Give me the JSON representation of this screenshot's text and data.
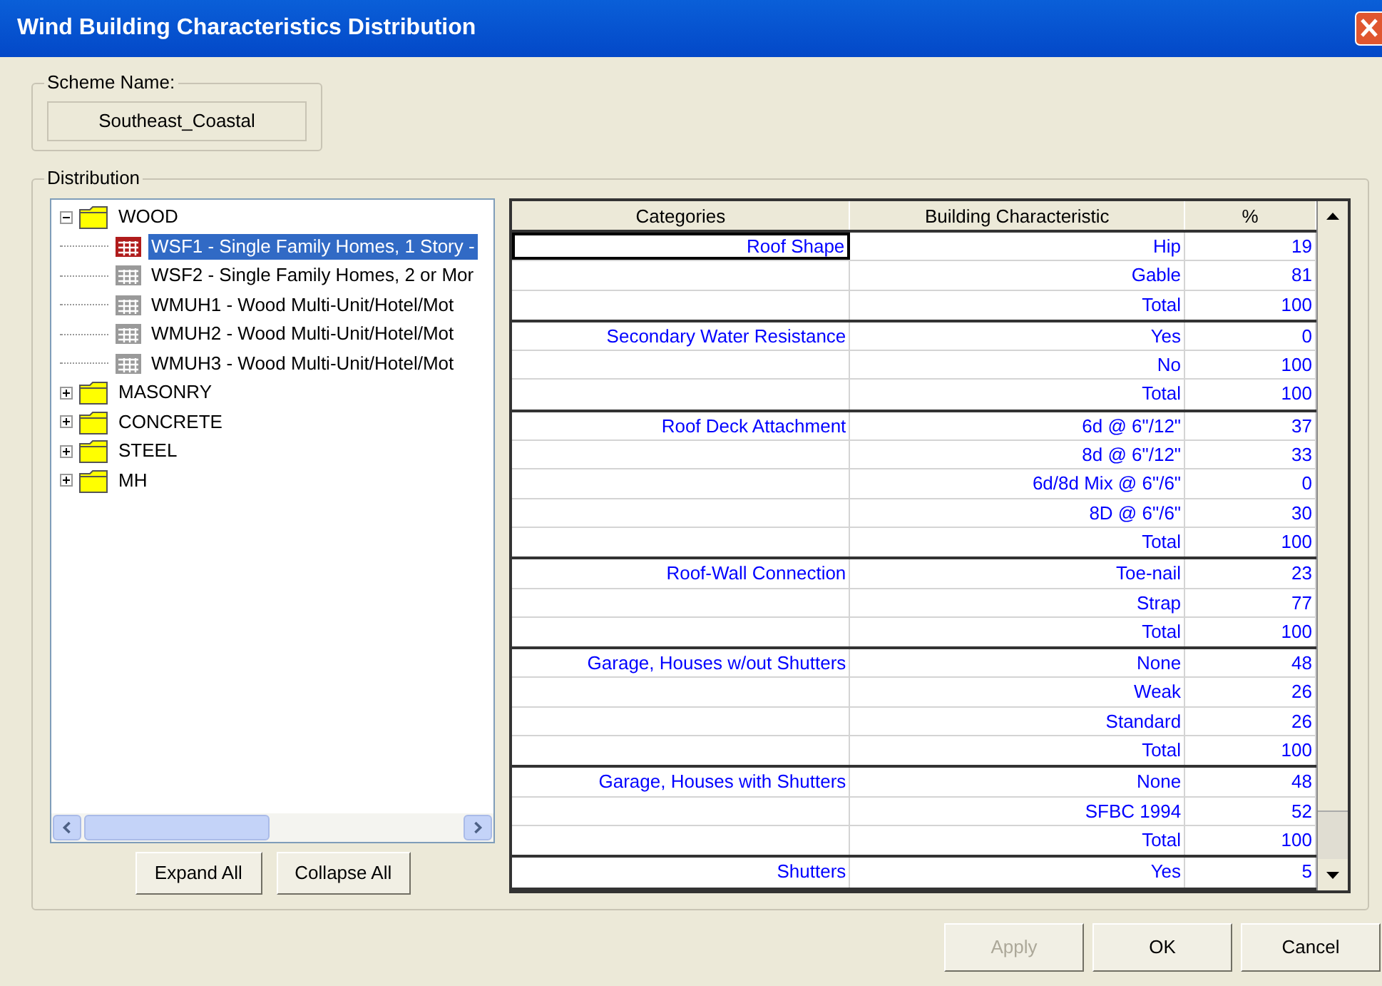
{
  "window": {
    "title": "Wind Building Characteristics Distribution"
  },
  "scheme": {
    "label": "Scheme Name:",
    "value": "Southeast_Coastal"
  },
  "distribution": {
    "label": "Distribution"
  },
  "tree": [
    {
      "label": "WOOD",
      "kind": "folder",
      "expanded": true,
      "selected": false,
      "children": [
        {
          "label": "WSF1 - Single Family Homes, 1 Story -",
          "kind": "item",
          "selected": true
        },
        {
          "label": "WSF2 - Single Family Homes, 2 or Mor",
          "kind": "item",
          "selected": false
        },
        {
          "label": "WMUH1 - Wood Multi-Unit/Hotel/Mot",
          "kind": "item",
          "selected": false
        },
        {
          "label": "WMUH2 - Wood Multi-Unit/Hotel/Mot",
          "kind": "item",
          "selected": false
        },
        {
          "label": "WMUH3 - Wood Multi-Unit/Hotel/Mot",
          "kind": "item",
          "selected": false
        }
      ]
    },
    {
      "label": "MASONRY",
      "kind": "folder",
      "expanded": false,
      "selected": false
    },
    {
      "label": "CONCRETE",
      "kind": "folder",
      "expanded": false,
      "selected": false
    },
    {
      "label": "STEEL",
      "kind": "folder",
      "expanded": false,
      "selected": false
    },
    {
      "label": "MH",
      "kind": "folder",
      "expanded": false,
      "selected": false
    }
  ],
  "tree_buttons": [
    "Expand All",
    "Collapse All"
  ],
  "table": {
    "columns": [
      "Categories",
      "Building Characteristic",
      "%"
    ],
    "groups": [
      {
        "category": "Roof Shape",
        "selected": true,
        "rows": [
          {
            "characteristic": "Hip",
            "percent": "19"
          },
          {
            "characteristic": "Gable",
            "percent": "81"
          },
          {
            "characteristic": "Total",
            "percent": "100"
          }
        ]
      },
      {
        "category": "Secondary Water Resistance",
        "selected": false,
        "rows": [
          {
            "characteristic": "Yes",
            "percent": "0"
          },
          {
            "characteristic": "No",
            "percent": "100"
          },
          {
            "characteristic": "Total",
            "percent": "100"
          }
        ]
      },
      {
        "category": "Roof Deck Attachment",
        "selected": false,
        "rows": [
          {
            "characteristic": "6d @ 6\"/12\"",
            "percent": "37"
          },
          {
            "characteristic": "8d @ 6\"/12\"",
            "percent": "33"
          },
          {
            "characteristic": "6d/8d Mix @ 6\"/6\"",
            "percent": "0"
          },
          {
            "characteristic": "8D @ 6\"/6\"",
            "percent": "30"
          },
          {
            "characteristic": "Total",
            "percent": "100"
          }
        ]
      },
      {
        "category": "Roof-Wall Connection",
        "selected": false,
        "rows": [
          {
            "characteristic": "Toe-nail",
            "percent": "23"
          },
          {
            "characteristic": "Strap",
            "percent": "77"
          },
          {
            "characteristic": "Total",
            "percent": "100"
          }
        ]
      },
      {
        "category": "Garage, Houses w/out Shutters",
        "selected": false,
        "rows": [
          {
            "characteristic": "None",
            "percent": "48"
          },
          {
            "characteristic": "Weak",
            "percent": "26"
          },
          {
            "characteristic": "Standard",
            "percent": "26"
          },
          {
            "characteristic": "Total",
            "percent": "100"
          }
        ]
      },
      {
        "category": "Garage, Houses with Shutters",
        "selected": false,
        "rows": [
          {
            "characteristic": "None",
            "percent": "48"
          },
          {
            "characteristic": "SFBC 1994",
            "percent": "52"
          },
          {
            "characteristic": "Total",
            "percent": "100"
          }
        ]
      },
      {
        "category": "Shutters",
        "selected": false,
        "rows": [
          {
            "characteristic": "Yes",
            "percent": "5"
          }
        ]
      }
    ]
  },
  "buttons": [
    {
      "label": "Apply",
      "disabled": true
    },
    {
      "label": "OK",
      "disabled": false
    },
    {
      "label": "Cancel",
      "disabled": false
    }
  ]
}
